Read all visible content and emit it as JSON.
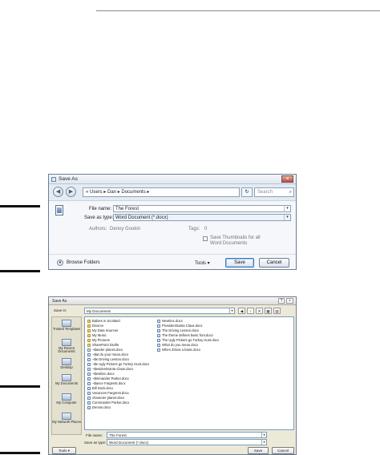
{
  "dialog_vista": {
    "title": "Save As",
    "close_glyph": "×",
    "back_glyph": "◀",
    "forward_glyph": "▶",
    "address_path": "« Users ▸ Dan ▸ Documents ▸",
    "refresh_glyph": "↻",
    "search_placeholder": "Search",
    "search_glyph": "⌕",
    "file_name_label": "File name:",
    "file_name_value": "The Forest",
    "save_as_type_label": "Save as type:",
    "save_as_type_value": "Word Document (*.docx)",
    "dropdown_glyph": "▾",
    "authors_label": "Authors:",
    "authors_value": "Denny Gookin",
    "tags_label": "Tags:",
    "tags_value": "0",
    "thumbnail_label_1": "Save Thumbnails for all",
    "thumbnail_label_2": "Word Documents",
    "browse_folders_label": "Browse Folders",
    "browse_glyph": "▾",
    "tools_label": "Tools ▾",
    "save_label": "Save",
    "cancel_label": "Cancel"
  },
  "dialog_classic": {
    "title": "Save As",
    "help_glyph": "?",
    "close_glyph": "×",
    "save_in_label": "Save in:",
    "save_in_value": "My Documents",
    "toolbar_glyphs": [
      "◀",
      "↑",
      "✕",
      "▦",
      "▤"
    ],
    "places": [
      {
        "label": "Trusted Templates"
      },
      {
        "label": "My Recent Documents"
      },
      {
        "label": "Desktop"
      },
      {
        "label": "My Documents"
      },
      {
        "label": "My Computer"
      },
      {
        "label": "My Network Places"
      }
    ],
    "files_col1": [
      {
        "name": "Babies in Scotland",
        "kind": "folder"
      },
      {
        "name": "Divorce",
        "kind": "folder"
      },
      {
        "name": "My Data Sources",
        "kind": "folder"
      },
      {
        "name": "My Music",
        "kind": "folder"
      },
      {
        "name": "My Pictures",
        "kind": "folder"
      },
      {
        "name": "SharePoint Drafts",
        "kind": "folder"
      },
      {
        "name": "~$ander planet.docx",
        "kind": "file"
      },
      {
        "name": "~$at do your mean.docx",
        "kind": "file"
      },
      {
        "name": "~$e Driving Lesson.docx",
        "kind": "file"
      },
      {
        "name": "~$e Ugly Pickers go Turkey Hunt.docx",
        "kind": "file"
      },
      {
        "name": "~$esidentSanta Claus.docx",
        "kind": "file"
      },
      {
        "name": "~$ewDoc.docx",
        "kind": "file"
      },
      {
        "name": "~$mmander Parker.docx",
        "kind": "file"
      },
      {
        "name": "~$ance Fargenst.docx",
        "kind": "file"
      },
      {
        "name": "Bill Sack.docx",
        "kind": "file"
      },
      {
        "name": "Vacances Fargenst.docx",
        "kind": "file"
      },
      {
        "name": "character planet.docx",
        "kind": "file"
      },
      {
        "name": "Commander Parker.docx",
        "kind": "file"
      },
      {
        "name": "Demos.docx",
        "kind": "file"
      }
    ],
    "files_col2": [
      {
        "name": "NewDoc.docx",
        "kind": "file"
      },
      {
        "name": "PresidentSanta Claus.docx",
        "kind": "file"
      },
      {
        "name": "The Driving Lesson.docx",
        "kind": "file"
      },
      {
        "name": "The theme defines basic font.docx",
        "kind": "file"
      },
      {
        "name": "The Ugly Pickers go Turkey Hunt.docx",
        "kind": "file"
      },
      {
        "name": "What do you mean.docx",
        "kind": "file"
      },
      {
        "name": "When Zimos a basic.docx",
        "kind": "file"
      }
    ],
    "file_name_label": "File name:",
    "file_name_value": "The Forest",
    "save_as_type_label": "Save as type:",
    "save_as_type_value": "Word Document (*.docx)",
    "dropdown_glyph": "▾",
    "tools_label": "Tools ▾",
    "save_label": "Save",
    "cancel_label": "Cancel"
  }
}
